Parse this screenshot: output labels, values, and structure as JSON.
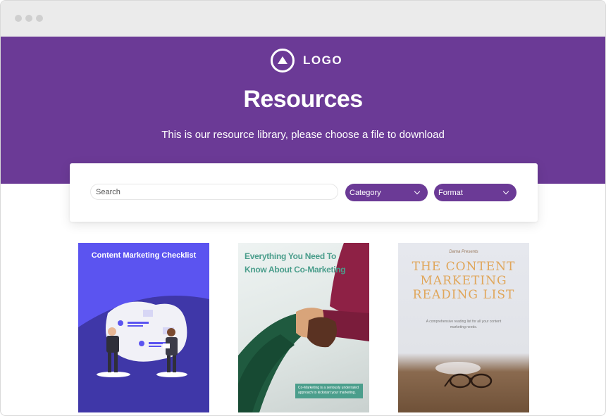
{
  "header": {
    "logo_text": "LOGO",
    "title": "Resources",
    "subtitle": "This is our resource library, please choose a file to download"
  },
  "filters": {
    "search_placeholder": "Search",
    "category_label": "Category",
    "format_label": "Format"
  },
  "cards": [
    {
      "title": "Content Marketing Checklist"
    },
    {
      "title": "Everything You Need To Know About Co-Marketing",
      "box_text": "Co-Marketing is a seriously underrated approach to kickstart your marketing."
    },
    {
      "small_text": "Dama Presents",
      "title": "THE CONTENT MARKETING READING LIST",
      "desc": "A comprehensive reading list for all your content marketing needs."
    }
  ],
  "colors": {
    "brand_purple": "#6b3a96",
    "card1_bg": "#5b54f0",
    "card2_accent": "#4b9e8c",
    "card3_title": "#e0a65a"
  },
  "icons": [
    "logo-triangle-icon",
    "chevron-down-icon"
  ]
}
